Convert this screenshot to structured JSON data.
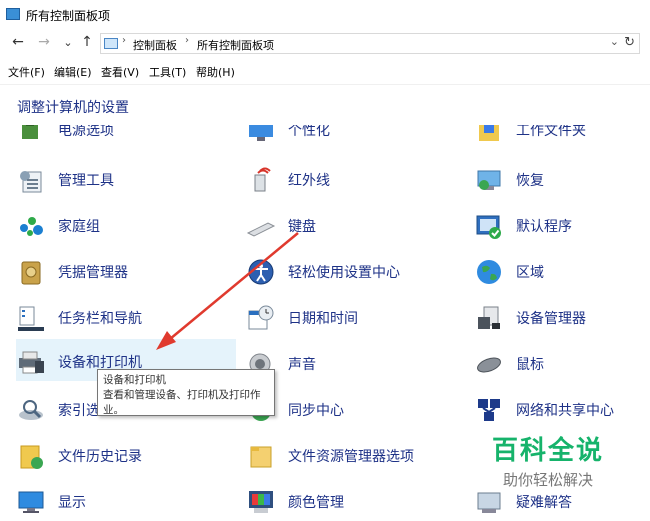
{
  "window": {
    "title": "所有控制面板项"
  },
  "address": {
    "crumbs": [
      "控制面板",
      "所有控制面板项"
    ],
    "nav": {
      "back": "←",
      "forward": "→",
      "recent": "⌄",
      "up": "↑",
      "dropdown": "⌄",
      "refresh": "↻"
    }
  },
  "menu": [
    "文件(F)",
    "编辑(E)",
    "查看(V)",
    "工具(T)",
    "帮助(H)"
  ],
  "heading": "调整计算机的设置",
  "items": {
    "col1": [
      "电源选项",
      "管理工具",
      "家庭组",
      "凭据管理器",
      "任务栏和导航",
      "设备和打印机",
      "索引选",
      "文件历史记录",
      "显示"
    ],
    "col2": [
      "个性化",
      "红外线",
      "键盘",
      "轻松使用设置中心",
      "日期和时间",
      "声音",
      "同步中心",
      "文件资源管理器选项",
      "颜色管理"
    ],
    "col3": [
      "工作文件夹",
      "恢复",
      "默认程序",
      "区域",
      "设备管理器",
      "鼠标",
      "网络和共享中心",
      "",
      "疑难解答"
    ]
  },
  "tooltip": {
    "title": "设备和打印机",
    "desc": "查看和管理设备、打印机及打印作业。"
  },
  "watermark": {
    "title": "百科全说",
    "sub": "助你轻松解决"
  },
  "colors": {
    "link": "#1e3287",
    "highlight": "#e5f3fb",
    "arrow": "#e03a2e",
    "watermark": "#16b36b"
  }
}
